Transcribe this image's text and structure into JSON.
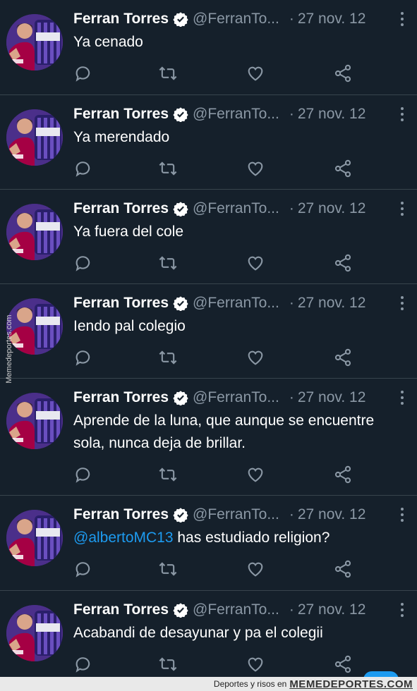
{
  "tweets": [
    {
      "name": "Ferran Torres",
      "handle": "@FerranTo...",
      "dot": "·",
      "date": "27 nov. 12",
      "text": "Ya cenado",
      "mention": ""
    },
    {
      "name": "Ferran Torres",
      "handle": "@FerranTo...",
      "dot": "·",
      "date": "27 nov. 12",
      "text": "Ya merendado",
      "mention": ""
    },
    {
      "name": "Ferran Torres",
      "handle": "@FerranTo...",
      "dot": "·",
      "date": "27 nov. 12",
      "text": "Ya fuera del cole",
      "mention": ""
    },
    {
      "name": "Ferran Torres",
      "handle": "@FerranTo...",
      "dot": "·",
      "date": "27 nov. 12",
      "text": "Iendo pal colegio",
      "mention": ""
    },
    {
      "name": "Ferran Torres",
      "handle": "@FerranTo...",
      "dot": "·",
      "date": "27 nov. 12",
      "text": "Aprende de la luna, que aunque se encuentre sola, nunca deja de brillar.",
      "mention": ""
    },
    {
      "name": "Ferran Torres",
      "handle": "@FerranTo...",
      "dot": "·",
      "date": "27 nov. 12",
      "text": " has estudiado religion?",
      "mention": "@albertoMC13"
    },
    {
      "name": "Ferran Torres",
      "handle": "@FerranTo...",
      "dot": "·",
      "date": "27 nov. 12",
      "text": "Acabandi de desayunar y pa el colegii",
      "mention": ""
    }
  ],
  "watermark": "Memedeportes.com",
  "footer": {
    "tagline": "Deportes y risos en",
    "brand": "MEMEDEPORTES.COM"
  },
  "icons": {
    "reply": "reply-icon",
    "retweet": "retweet-icon",
    "like": "heart-icon",
    "share": "share-icon",
    "more": "more-icon",
    "verified": "verified-badge-icon"
  },
  "colors": {
    "background": "#15202b",
    "secondary_text": "#8b98a5",
    "mention": "#1d9bf0",
    "divider": "#38444d"
  }
}
